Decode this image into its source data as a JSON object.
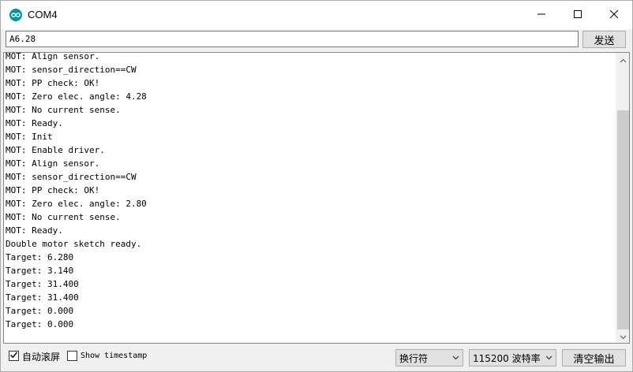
{
  "window": {
    "title": "COM4"
  },
  "send": {
    "input_value": "A6.28",
    "button_label": "发送"
  },
  "monitor": {
    "lines": [
      "MOT: Align sensor.",
      "MOT: sensor_direction==CW",
      "MOT: PP check: OK!",
      "MOT: Zero elec. angle: 4.28",
      "MOT: No current sense.",
      "MOT: Ready.",
      "MOT: Init",
      "MOT: Enable driver.",
      "MOT: Align sensor.",
      "MOT: sensor_direction==CW",
      "MOT: PP check: OK!",
      "MOT: Zero elec. angle: 2.80",
      "MOT: No current sense.",
      "MOT: Ready.",
      "Double motor sketch ready.",
      "Target: 6.280",
      "Target: 3.140",
      "Target: 31.400",
      "Target: 31.400",
      "Target: 0.000",
      "Target: 0.000"
    ]
  },
  "footer": {
    "autoscroll_label": "自动滚屏",
    "autoscroll_checked": true,
    "timestamp_label": "Show timestamp",
    "timestamp_checked": false,
    "line_ending_value": "换行符",
    "baud_value": "115200 波特率",
    "clear_label": "清空输出"
  },
  "icons": {
    "app": "arduino-icon",
    "minimize": "minimize-icon",
    "maximize": "maximize-icon",
    "close": "close-icon",
    "scroll_up": "chevron-up-icon",
    "scroll_down": "chevron-down-icon",
    "dropdown": "chevron-down-icon",
    "check": "check-icon"
  },
  "colors": {
    "accent": "#00979d",
    "scroll_thumb": "#cdcdcd"
  }
}
